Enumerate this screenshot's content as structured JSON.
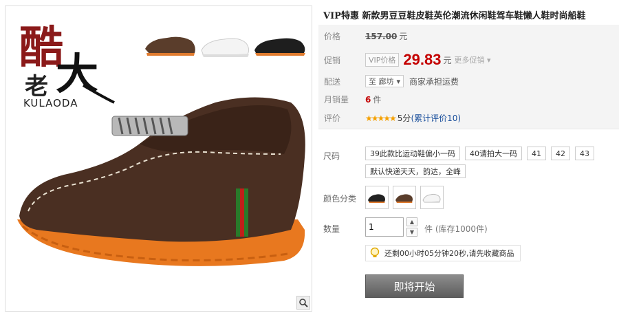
{
  "brand": {
    "cn_big": "酷",
    "cn_mid": "老",
    "cn_bold": "大",
    "latin": "KULAODA"
  },
  "product": {
    "title": "VIP特惠 新款男豆豆鞋皮鞋英伦潮流休闲鞋驾车鞋懒人鞋时尚船鞋"
  },
  "price_panel": {
    "price_label": "价格",
    "original_price": "157.00",
    "currency": "元",
    "promo_label": "促销",
    "vip_tag": "VIP价格",
    "promo_price": "29.83",
    "more_promos": "更多促销",
    "shipping_label": "配送",
    "ship_from": "至 廊坊",
    "ship_note": "商家承担运费",
    "monthly_sales_label": "月销量",
    "monthly_sales": "6",
    "monthly_sales_unit": "件",
    "rating_label": "评价",
    "stars": "★★★★★",
    "score": "5分",
    "review_count_text": "(累计评价10)"
  },
  "size": {
    "label": "尺码",
    "options": [
      "39此款比运动鞋偏小一码",
      "40请拍大一码",
      "41",
      "42",
      "43",
      "默认快递天天，韵达，全峰"
    ]
  },
  "color": {
    "label": "颜色分类",
    "swatches": [
      "black",
      "brown",
      "white"
    ]
  },
  "quantity": {
    "label": "数量",
    "value": "1",
    "stock_note": "件 (库存1000件)"
  },
  "countdown": {
    "text": "还剩00小时05分钟20秒,请先收藏商品"
  },
  "button": {
    "label": "即将开始"
  },
  "colors": {
    "price_red": "#c40000",
    "star": "#f5a000",
    "link": "#1a4f9c",
    "button": "#6e6e6e"
  }
}
